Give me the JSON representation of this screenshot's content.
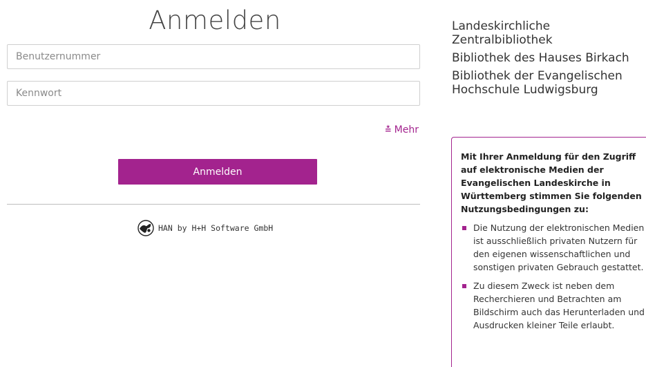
{
  "login": {
    "title": "Anmelden",
    "username_placeholder": "Benutzernummer",
    "password_placeholder": "Kennwort",
    "more_label": "Mehr",
    "submit_label": "Anmelden"
  },
  "footer": {
    "han_text": "HAN by H+H Software GmbH",
    "logo_icon": "han-globe-icon"
  },
  "libraries": [
    "Landeskirchliche Zentralbibliothek",
    "Bibliothek des Hauses Birkach",
    "Bibliothek der Evangelischen Hochschule Ludwigsburg"
  ],
  "terms": {
    "intro": "Mit Ihrer Anmeldung für den Zugriff auf elektronische Medien der Evangelischen Landeskirche in Württemberg stimmen Sie folgenden Nutzungsbedingungen zu:",
    "items": [
      "Die Nutzung der elektronischen Medien ist ausschließlich privaten Nutzern für den eigenen wissenschaftlichen und sonstigen privaten Gebrauch gestattet.",
      "Zu diesem Zweck ist neben dem Recherchieren und Betrachten am Bildschirm auch das Herunterladen und Ausdrucken kleiner Teile erlaubt."
    ]
  },
  "colors": {
    "accent": "#a3238e",
    "text": "#333333",
    "border": "#cfcfcf"
  }
}
